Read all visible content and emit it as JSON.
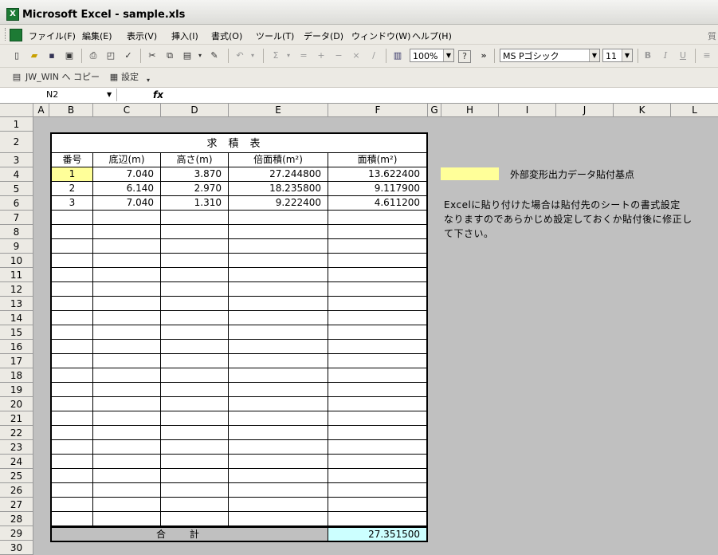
{
  "window": {
    "title": "Microsoft Excel - sample.xls"
  },
  "menu": [
    "ファイル(F)",
    "編集(E)",
    "表示(V)",
    "挿入(I)",
    "書式(O)",
    "ツール(T)",
    "データ(D)",
    "ウィンドウ(W)",
    "ヘルプ(H)"
  ],
  "menu_right_text": "質",
  "toolbar": {
    "zoom": "100%",
    "font_name": "MS Pゴシック",
    "font_size": "11",
    "sigma": "Σ",
    "more": "»",
    "help": "?",
    "bold": "B",
    "italic": "I",
    "underline": "U"
  },
  "toolbar2": {
    "jw_copy": "JW_WIN へ コピー",
    "settings": "設定"
  },
  "formula_bar": {
    "name_box": "N2",
    "fx": "fx",
    "value": ""
  },
  "columns": [
    "A",
    "B",
    "C",
    "D",
    "E",
    "F",
    "G",
    "H",
    "I",
    "J",
    "K",
    "L"
  ],
  "rows": [
    "1",
    "2",
    "3",
    "4",
    "5",
    "6",
    "7",
    "8",
    "9",
    "10",
    "11",
    "12",
    "13",
    "14",
    "15",
    "16",
    "17",
    "18",
    "19",
    "20",
    "21",
    "22",
    "23",
    "24",
    "25",
    "26",
    "27",
    "28",
    "29",
    "30"
  ],
  "table": {
    "title": "求積表",
    "headers": [
      "番号",
      "底辺(m)",
      "高さ(m)",
      "倍面積(m²)",
      "面積(m²)"
    ],
    "data": [
      [
        "1",
        "7.040",
        "3.870",
        "27.244800",
        "13.622400"
      ],
      [
        "2",
        "6.140",
        "2.970",
        "18.235800",
        "9.117900"
      ],
      [
        "3",
        "7.040",
        "1.310",
        "9.222400",
        "4.611200"
      ]
    ],
    "total_label": "合計",
    "total_value": "27.351500"
  },
  "legend": {
    "text": "外部変形出力データ貼付基点",
    "color": "#ffff99"
  },
  "note": {
    "line1": "Excelに貼り付けた場合は貼付先のシートの書式設定",
    "line2": "なりますのであらかじめ設定しておくか貼付後に修正し",
    "line3": "て下さい。"
  },
  "colors": {
    "total_fill": "#ccffff",
    "highlight": "#ffff99",
    "sheet_bg": "#c0c0c0"
  }
}
